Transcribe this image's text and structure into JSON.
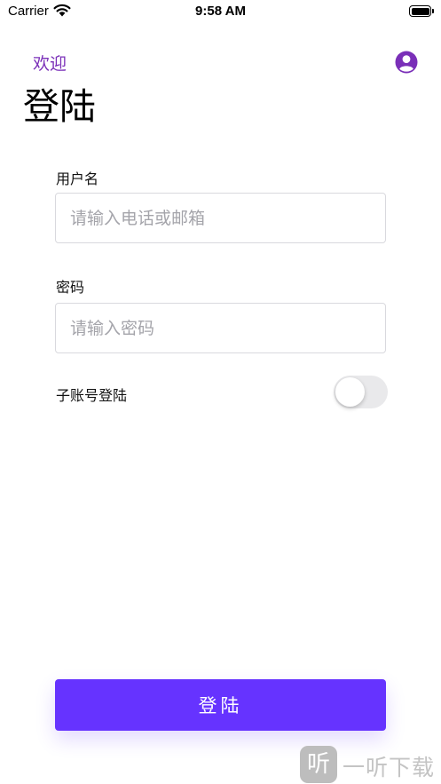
{
  "status_bar": {
    "carrier": "Carrier",
    "time": "9:58 AM"
  },
  "nav": {
    "welcome": "欢迎",
    "profile_icon": "user-circle-icon"
  },
  "page": {
    "title": "登陆"
  },
  "form": {
    "username_label": "用户名",
    "username_placeholder": "请输入电话或邮箱",
    "password_label": "密码",
    "password_placeholder": "请输入密码",
    "sub_account_label": "子账号登陆",
    "sub_account_enabled": false
  },
  "login_button": {
    "label": "登陆"
  },
  "watermark": {
    "logo_char": "听",
    "text": "一听下载"
  },
  "colors": {
    "accent": "#6633ff",
    "welcome": "#7a2fb8",
    "input_border": "#d9d9de",
    "toggle_off": "#e9e9eb"
  }
}
